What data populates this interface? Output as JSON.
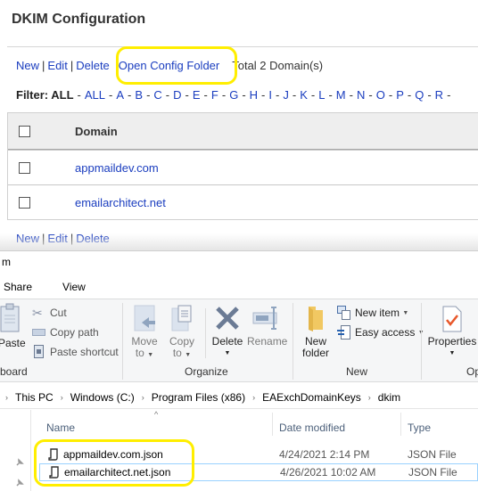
{
  "web": {
    "title": "DKIM Configuration",
    "toolbar": {
      "new": "New",
      "edit": "Edit",
      "delete": "Delete",
      "separator": "|",
      "open_config_folder": "Open Config Folder",
      "total": "Total 2 Domain(s)"
    },
    "filter": {
      "label": "Filter:",
      "current": "ALL",
      "letters": [
        "ALL",
        "A",
        "B",
        "C",
        "D",
        "E",
        "F",
        "G",
        "H",
        "I",
        "J",
        "K",
        "L",
        "M",
        "N",
        "O",
        "P",
        "Q",
        "R"
      ]
    },
    "table": {
      "header": "Domain",
      "rows": [
        "appmaildev.com",
        "emailarchitect.net"
      ]
    },
    "toolbar_bottom": {
      "new": "New",
      "edit": "Edit",
      "delete": "Delete"
    },
    "colors": {
      "link": "#1a3dbf",
      "highlight": "#ffee00",
      "header_bg": "#eeeeee"
    }
  },
  "explorer": {
    "title": "m",
    "tabs": [
      "Share",
      "View"
    ],
    "ribbon": {
      "clipboard": {
        "label": "board",
        "paste": "Paste",
        "cut": "Cut",
        "copy_path": "Copy path",
        "paste_shortcut": "Paste shortcut"
      },
      "organize": {
        "label": "Organize",
        "move_to": [
          "Move",
          "to"
        ],
        "copy_to": [
          "Copy",
          "to"
        ],
        "delete": "Delete",
        "rename": "Rename"
      },
      "new": {
        "label": "New",
        "new_folder": [
          "New",
          "folder"
        ],
        "new_item": "New item",
        "easy_access": "Easy access"
      },
      "open": {
        "label": "Op",
        "properties": "Properties"
      }
    },
    "breadcrumb": [
      "This PC",
      "Windows (C:)",
      "Program Files (x86)",
      "EAExchDomainKeys",
      "dkim"
    ],
    "columns": {
      "name": "Name",
      "date": "Date modified",
      "type": "Type"
    },
    "files": [
      {
        "name": "appmaildev.com.json",
        "date": "4/24/2021 2:14 PM",
        "type": "JSON File"
      },
      {
        "name": "emailarchitect.net.json",
        "date": "4/26/2021 10:02 AM",
        "type": "JSON File"
      }
    ],
    "colors": {
      "ribbon_bg": "#f5f6f7",
      "column_text": "#4c607a",
      "selection_border": "#99d1ff",
      "properties_check": "#e8572a"
    }
  }
}
